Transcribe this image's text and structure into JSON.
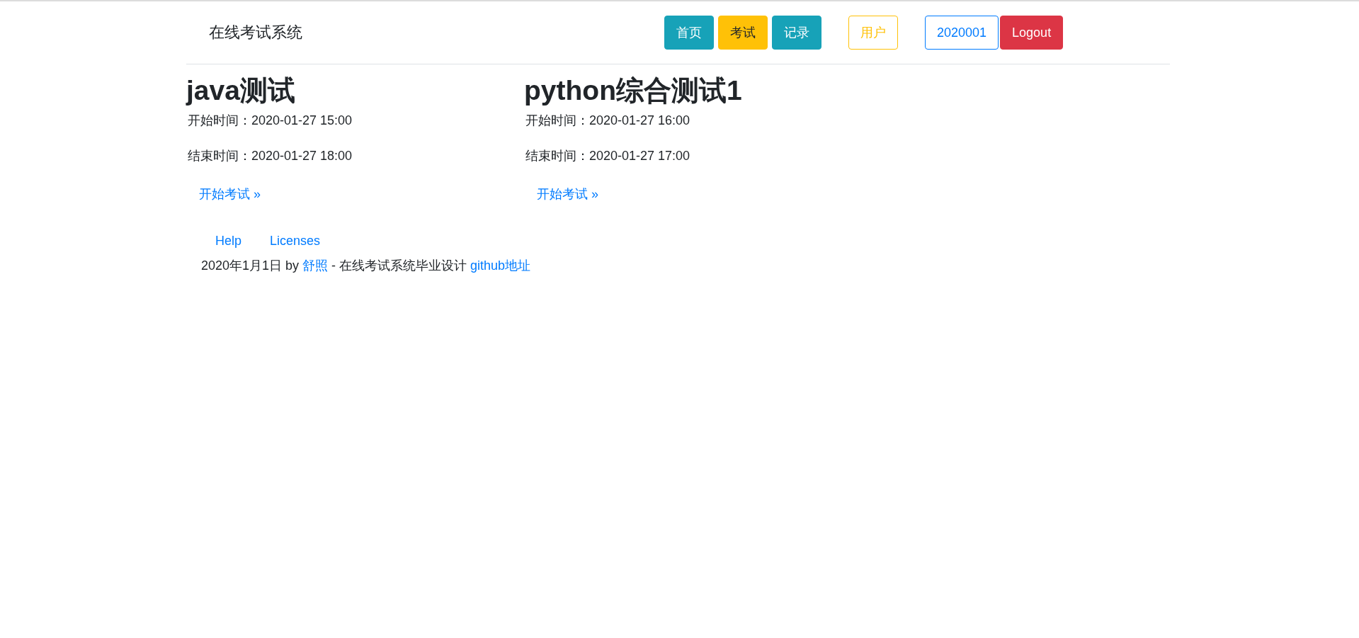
{
  "navbar": {
    "brand": "在线考试系统",
    "buttons": [
      {
        "label": "首页",
        "kind": "info"
      },
      {
        "label": "考试",
        "kind": "warning"
      },
      {
        "label": "记录",
        "kind": "info"
      },
      {
        "label": "用户",
        "kind": "outline-warning"
      },
      {
        "label": "2020001",
        "kind": "outline-primary"
      },
      {
        "label": "Logout",
        "kind": "danger"
      }
    ]
  },
  "exams": [
    {
      "title": "java测试",
      "start": "开始时间：2020-01-27 15:00",
      "end": "结束时间：2020-01-27 18:00",
      "link": "开始考试 »"
    },
    {
      "title": "python综合测试1",
      "start": "开始时间：2020-01-27 16:00",
      "end": "结束时间：2020-01-27 17:00",
      "link": "开始考试 »"
    }
  ],
  "footer": {
    "links": [
      "Help",
      "Licenses"
    ],
    "text_before": "2020年1月1日 by",
    "author": "舒照",
    "text_middle": "- 在线考试系统毕业设计",
    "repo_link": "github地址"
  }
}
